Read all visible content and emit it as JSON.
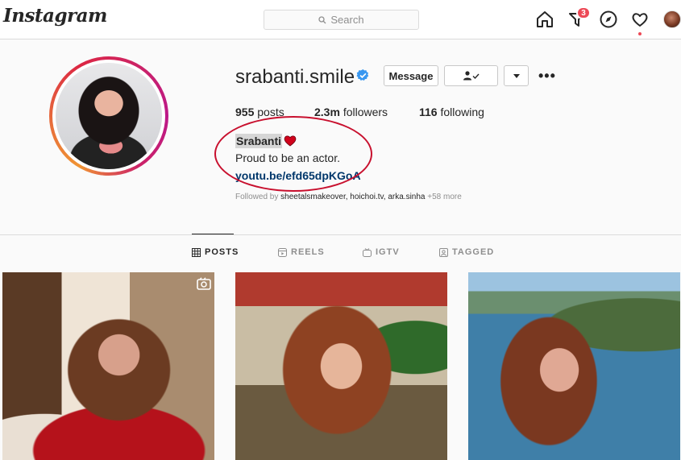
{
  "header": {
    "logo": "Instagram",
    "search_placeholder": "Search",
    "activity_badge": "3"
  },
  "profile": {
    "username": "srabanti.smile",
    "message_label": "Message",
    "stats": {
      "posts_count": "955",
      "posts_label": "posts",
      "followers_count": "2.3m",
      "followers_label": "followers",
      "following_count": "116",
      "following_label": "following"
    },
    "name": "Srabanti",
    "bio": "Proud to be an actor.",
    "link": "youtu.be/efd65dpKGoA",
    "followed_by_prefix": "Followed by",
    "followed_by_users": "sheetalsmakeover, hoichoi.tv, arka.sinha",
    "followed_by_more": "+58 more"
  },
  "tabs": [
    {
      "label": "POSTS",
      "active": true
    },
    {
      "label": "REELS",
      "active": false
    },
    {
      "label": "IGTV",
      "active": false
    },
    {
      "label": "TAGGED",
      "active": false
    }
  ],
  "colors": {
    "verified": "#3897f0",
    "notification": "#ed4956",
    "link": "#00376b",
    "annotation": "#c8102e"
  }
}
